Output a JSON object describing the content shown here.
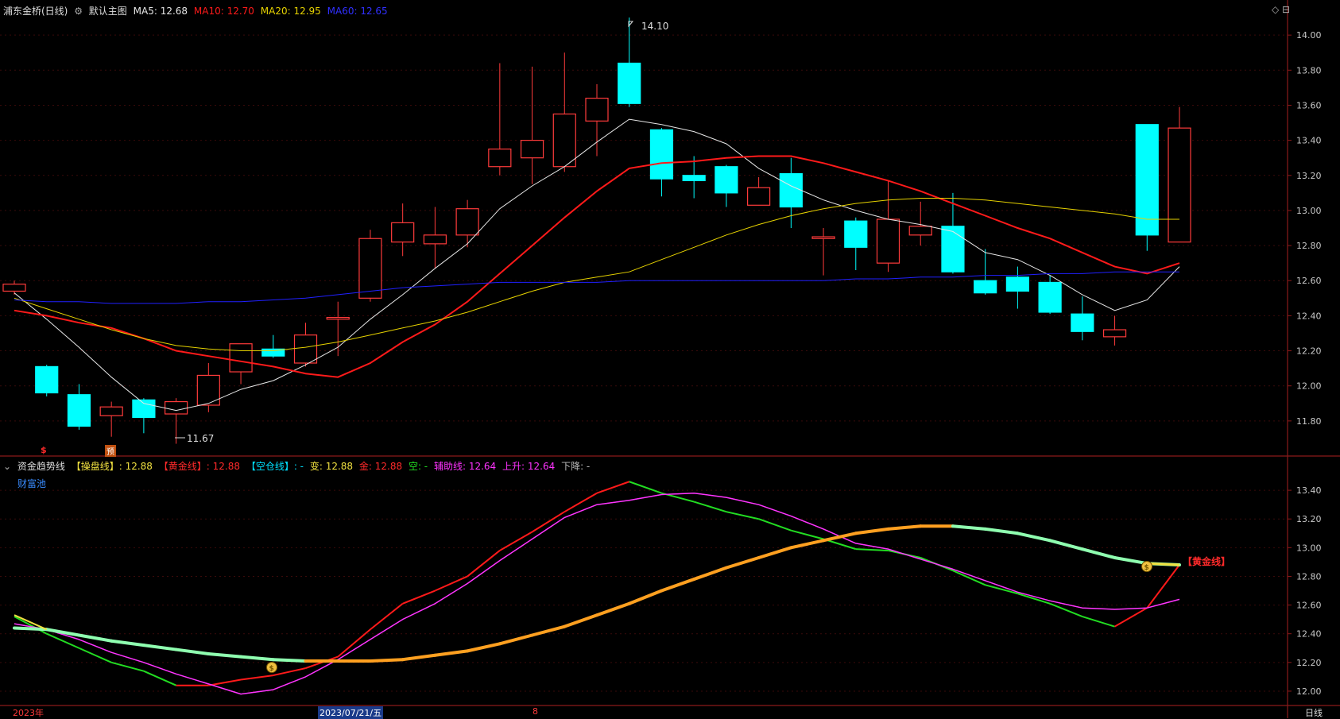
{
  "header": {
    "stock": "浦东金桥(日线)",
    "main_chart_btn": "默认主图",
    "ma5": "MA5: 12.68",
    "ma10": "MA10: 12.70",
    "ma20": "MA20: 12.95",
    "ma60": "MA60: 12.65"
  },
  "sub_header": {
    "indicator": "资金趋势线",
    "cao_pan": "【操盘线】: 12.88",
    "huang_jin": "【黄金线】: 12.88",
    "kong_cang": "【空仓线】: -",
    "bian": "变: 12.88",
    "jin": "金: 12.88",
    "kong": "空: -",
    "fu_zhu": "辅助线: 12.64",
    "shang_sheng": "上升: 12.64",
    "xia_jiang": "下降: -",
    "cai_fu_chi": "财富池"
  },
  "labels": {
    "high": "14.10",
    "low": "11.67",
    "dollar_marker": "$",
    "yu_marker": "预",
    "huang_jin_tag": "【黄金线】",
    "year": "2023年",
    "date": "2023/07/21/五",
    "month_mark": "8",
    "period": "日线",
    "toolbar_icons": "◇ ⊟"
  },
  "colors": {
    "up": "#ff3b3b",
    "down": "#00ffff",
    "ma5": "#e6e6e6",
    "ma10": "#ff1a1a",
    "ma20": "#e6d200",
    "ma60": "#2020ff",
    "magenta": "#ff33ff",
    "green": "#22dd22"
  },
  "chart_data": [
    {
      "type": "candlestick",
      "title": "浦东金桥(日线)",
      "y_ticks": [
        "14.00",
        "13.80",
        "13.60",
        "13.40",
        "13.20",
        "13.00",
        "12.80",
        "12.60",
        "12.40",
        "12.20",
        "12.00",
        "11.80"
      ],
      "ylim": [
        11.6,
        14.2
      ],
      "candles": [
        {
          "o": 12.54,
          "c": 12.58,
          "h": 12.6,
          "l": 12.52
        },
        {
          "o": 12.11,
          "c": 11.96,
          "h": 12.12,
          "l": 11.94
        },
        {
          "o": 11.95,
          "c": 11.77,
          "h": 12.01,
          "l": 11.75
        },
        {
          "o": 11.83,
          "c": 11.88,
          "h": 11.91,
          "l": 11.71
        },
        {
          "o": 11.92,
          "c": 11.82,
          "h": 11.93,
          "l": 11.73
        },
        {
          "o": 11.84,
          "c": 11.91,
          "h": 11.93,
          "l": 11.67
        },
        {
          "o": 11.89,
          "c": 12.06,
          "h": 12.13,
          "l": 11.85
        },
        {
          "o": 12.08,
          "c": 12.24,
          "h": 12.24,
          "l": 12.01
        },
        {
          "o": 12.21,
          "c": 12.17,
          "h": 12.29,
          "l": 12.16
        },
        {
          "o": 12.13,
          "c": 12.29,
          "h": 12.36,
          "l": 12.11
        },
        {
          "o": 12.38,
          "c": 12.39,
          "h": 12.48,
          "l": 12.17
        },
        {
          "o": 12.5,
          "c": 12.84,
          "h": 12.89,
          "l": 12.48
        },
        {
          "o": 12.82,
          "c": 12.93,
          "h": 13.04,
          "l": 12.74
        },
        {
          "o": 12.81,
          "c": 12.86,
          "h": 13.02,
          "l": 12.67
        },
        {
          "o": 12.86,
          "c": 13.01,
          "h": 13.06,
          "l": 12.79
        },
        {
          "o": 13.25,
          "c": 13.35,
          "h": 13.84,
          "l": 13.2
        },
        {
          "o": 13.3,
          "c": 13.4,
          "h": 13.82,
          "l": 13.15
        },
        {
          "o": 13.25,
          "c": 13.55,
          "h": 13.9,
          "l": 13.22
        },
        {
          "o": 13.51,
          "c": 13.64,
          "h": 13.72,
          "l": 13.31
        },
        {
          "o": 13.84,
          "c": 13.61,
          "h": 14.1,
          "l": 13.59
        },
        {
          "o": 13.46,
          "c": 13.18,
          "h": 13.47,
          "l": 13.08
        },
        {
          "o": 13.2,
          "c": 13.17,
          "h": 13.31,
          "l": 13.07
        },
        {
          "o": 13.25,
          "c": 13.1,
          "h": 13.26,
          "l": 13.02
        },
        {
          "o": 13.03,
          "c": 13.13,
          "h": 13.19,
          "l": 13.03
        },
        {
          "o": 13.21,
          "c": 13.02,
          "h": 13.3,
          "l": 12.9
        },
        {
          "o": 12.84,
          "c": 12.85,
          "h": 12.9,
          "l": 12.63
        },
        {
          "o": 12.94,
          "c": 12.79,
          "h": 12.96,
          "l": 12.66
        },
        {
          "o": 12.7,
          "c": 12.95,
          "h": 13.17,
          "l": 12.65
        },
        {
          "o": 12.86,
          "c": 12.91,
          "h": 13.05,
          "l": 12.8
        },
        {
          "o": 12.91,
          "c": 12.65,
          "h": 13.1,
          "l": 12.64
        },
        {
          "o": 12.6,
          "c": 12.53,
          "h": 12.78,
          "l": 12.52
        },
        {
          "o": 12.62,
          "c": 12.54,
          "h": 12.68,
          "l": 12.44
        },
        {
          "o": 12.59,
          "c": 12.42,
          "h": 12.63,
          "l": 12.41
        },
        {
          "o": 12.41,
          "c": 12.31,
          "h": 12.51,
          "l": 12.26
        },
        {
          "o": 12.28,
          "c": 12.32,
          "h": 12.4,
          "l": 12.23
        },
        {
          "o": 13.49,
          "c": 12.86,
          "h": 13.49,
          "l": 12.77
        },
        {
          "o": 12.82,
          "c": 13.47,
          "h": 13.59,
          "l": 12.82
        }
      ],
      "series": [
        {
          "name": "MA5",
          "values": [
            12.53,
            12.38,
            12.22,
            12.05,
            11.9,
            11.86,
            11.9,
            11.98,
            12.03,
            12.12,
            12.22,
            12.38,
            12.52,
            12.67,
            12.81,
            13.01,
            13.14,
            13.25,
            13.39,
            13.52,
            13.49,
            13.45,
            13.38,
            13.24,
            13.14,
            13.06,
            13.0,
            12.95,
            12.92,
            12.88,
            12.76,
            12.72,
            12.63,
            12.52,
            12.43,
            12.49,
            12.68
          ]
        },
        {
          "name": "MA10",
          "values": [
            12.43,
            12.4,
            12.36,
            12.33,
            12.27,
            12.2,
            12.17,
            12.14,
            12.11,
            12.07,
            12.05,
            12.13,
            12.25,
            12.35,
            12.48,
            12.64,
            12.8,
            12.96,
            13.11,
            13.24,
            13.27,
            13.28,
            13.3,
            13.31,
            13.31,
            13.27,
            13.22,
            13.17,
            13.11,
            13.04,
            12.97,
            12.9,
            12.84,
            12.76,
            12.68,
            12.64,
            12.7
          ]
        },
        {
          "name": "MA20",
          "values": [
            12.5,
            12.44,
            12.38,
            12.32,
            12.27,
            12.23,
            12.21,
            12.2,
            12.2,
            12.22,
            12.25,
            12.29,
            12.33,
            12.37,
            12.42,
            12.48,
            12.54,
            12.59,
            12.62,
            12.65,
            12.72,
            12.79,
            12.86,
            12.92,
            12.97,
            13.01,
            13.04,
            13.06,
            13.07,
            13.07,
            13.06,
            13.04,
            13.02,
            13.0,
            12.98,
            12.95,
            12.95
          ]
        },
        {
          "name": "MA60",
          "values": [
            12.49,
            12.48,
            12.48,
            12.47,
            12.47,
            12.47,
            12.48,
            12.48,
            12.49,
            12.5,
            12.52,
            12.54,
            12.56,
            12.57,
            12.58,
            12.59,
            12.59,
            12.59,
            12.59,
            12.6,
            12.6,
            12.6,
            12.6,
            12.6,
            12.6,
            12.6,
            12.61,
            12.61,
            12.62,
            12.62,
            12.63,
            12.63,
            12.64,
            12.64,
            12.65,
            12.65,
            12.65
          ]
        }
      ]
    },
    {
      "type": "line",
      "title": "资金趋势线",
      "y_ticks": [
        "13.40",
        "13.20",
        "13.00",
        "12.80",
        "12.60",
        "12.40",
        "12.20",
        "12.00"
      ],
      "ylim": [
        11.9,
        13.55
      ],
      "series": [
        {
          "name": "操盘线",
          "values": [
            12.44,
            12.43,
            12.39,
            12.35,
            12.32,
            12.29,
            12.26,
            12.24,
            12.22,
            12.21,
            12.21,
            12.21,
            12.22,
            12.25,
            12.28,
            12.33,
            12.39,
            12.45,
            12.53,
            12.61,
            12.7,
            12.78,
            12.86,
            12.93,
            13.0,
            13.05,
            13.1,
            13.13,
            13.15,
            13.15,
            13.13,
            13.1,
            13.05,
            12.99,
            12.93,
            12.89,
            12.88
          ]
        },
        {
          "name": "辅助线",
          "values": [
            12.47,
            12.43,
            12.36,
            12.27,
            12.2,
            12.12,
            12.05,
            11.98,
            12.01,
            12.1,
            12.22,
            12.36,
            12.5,
            12.61,
            12.75,
            12.91,
            13.06,
            13.21,
            13.3,
            13.33,
            13.37,
            13.38,
            13.35,
            13.3,
            13.22,
            13.13,
            13.03,
            12.99,
            12.92,
            12.85,
            12.77,
            12.69,
            12.63,
            12.58,
            12.57,
            12.58,
            12.64
          ]
        },
        {
          "name": "红线",
          "values": [
            12.52,
            12.4,
            12.3,
            12.2,
            12.14,
            12.04,
            12.04,
            12.08,
            12.11,
            12.16,
            12.24,
            12.43,
            12.61,
            12.7,
            12.8,
            12.98,
            13.11,
            13.25,
            13.38,
            13.46,
            13.38,
            13.32,
            13.25,
            13.2,
            13.12,
            13.06,
            12.99,
            12.98,
            12.93,
            12.84,
            12.74,
            12.68,
            12.61,
            12.52,
            12.45,
            12.58,
            12.88
          ]
        },
        {
          "name": "绿线",
          "values": [
            12.53,
            12.4,
            12.16,
            12.06,
            11.97,
            11.96,
            11.99,
            12.06,
            12.12,
            12.18,
            12.26,
            12.43,
            12.61,
            12.7,
            12.8,
            12.98,
            13.11,
            13.25,
            13.38,
            13.47,
            13.37,
            13.32,
            13.24,
            13.21,
            13.14,
            13.03,
            12.95,
            12.95,
            12.94,
            12.85,
            12.74,
            12.68,
            12.6,
            12.5,
            12.44,
            12.58,
            12.88
          ]
        }
      ]
    }
  ]
}
